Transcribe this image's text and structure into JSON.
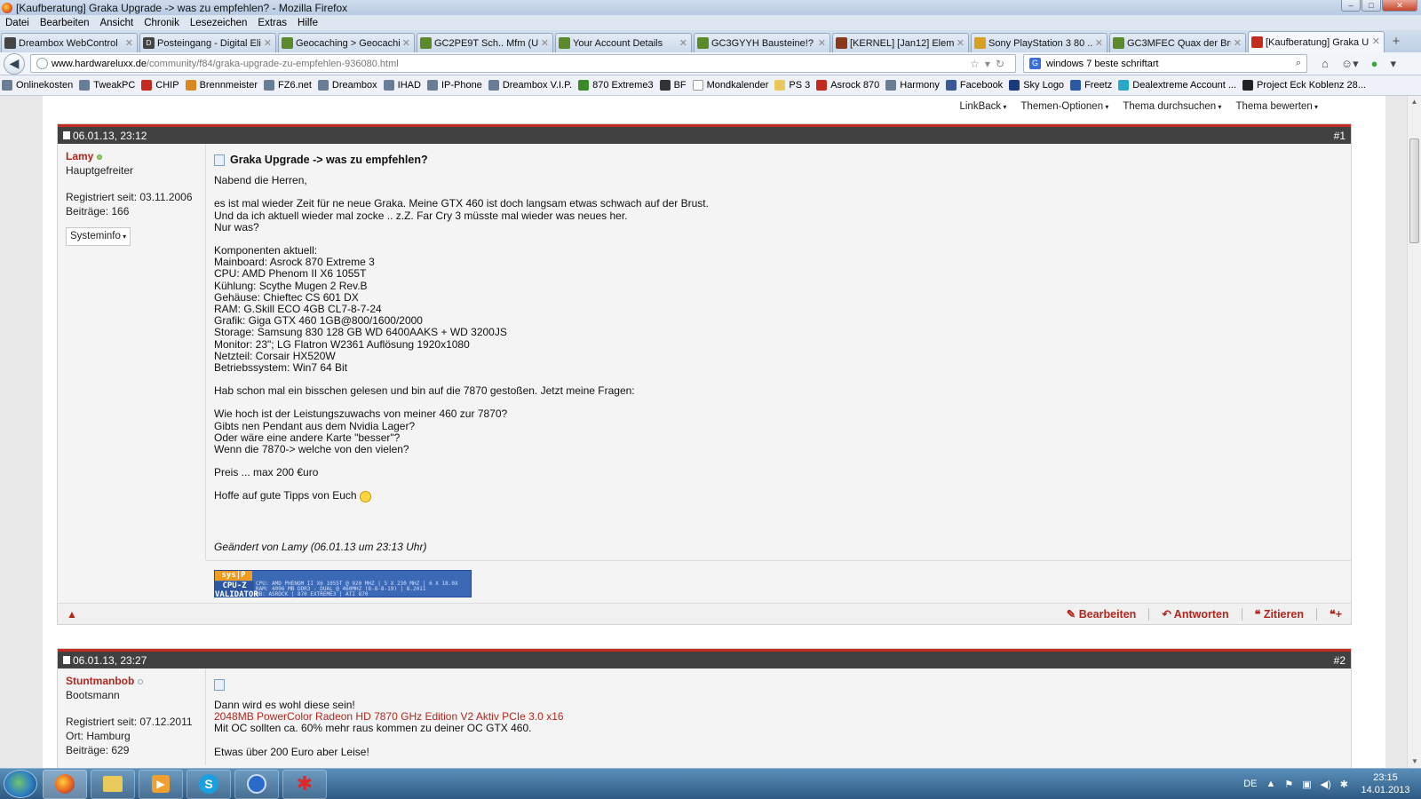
{
  "window": {
    "title": "[Kaufberatung] Graka Upgrade -> was zu empfehlen? - Mozilla Firefox"
  },
  "menu": [
    "Datei",
    "Bearbeiten",
    "Ansicht",
    "Chronik",
    "Lesezeichen",
    "Extras",
    "Hilfe"
  ],
  "tabs": [
    {
      "label": "Dreambox WebControl",
      "icon": "dreambox-icon"
    },
    {
      "label": "Posteingang - Digital Eli...",
      "icon": "mail-icon"
    },
    {
      "label": "Geocaching > Geocachi...",
      "icon": "geocaching-icon"
    },
    {
      "label": "GC2PE9T Sch.. Mfm (U...",
      "icon": "geocaching-icon"
    },
    {
      "label": "Your Account Details",
      "icon": "geocaching-icon"
    },
    {
      "label": "GC3GYYH Bausteine!? (...",
      "icon": "geocaching-icon"
    },
    {
      "label": "[KERNEL] [Jan12] Elem...",
      "icon": "forum-icon"
    },
    {
      "label": "Sony PlayStation 3 80 ...",
      "icon": "shop-icon"
    },
    {
      "label": "GC3MFEC Quax der Bru...",
      "icon": "geocaching-icon"
    },
    {
      "label": "[Kaufberatung] Graka U...",
      "icon": "hardwareluxx-icon"
    }
  ],
  "address": {
    "host": "www.hardwareluxx.de",
    "path": "/community/f84/graka-upgrade-zu-empfehlen-936080.html"
  },
  "search": {
    "value": "windows 7 beste schriftart"
  },
  "bookmarks": [
    "Onlinekosten",
    "TweakPC",
    "CHIP",
    "Brennmeister",
    "FZ6.net",
    "Dreambox",
    "IHAD",
    "IP-Phone",
    "Dreambox V.I.P.",
    "870 Extreme3",
    "BF",
    "Mondkalender",
    "PS 3",
    "Asrock 870",
    "Harmony",
    "Facebook",
    "Sky Logo",
    "Freetz",
    "Dealextreme Account ...",
    "Project Eck Koblenz 28..."
  ],
  "thread_tools": [
    "LinkBack",
    "Themen-Optionen",
    "Thema durchsuchen",
    "Thema bewerten"
  ],
  "posts": [
    {
      "date": "06.01.13, 23:12",
      "number": "#1",
      "user": "Lamy",
      "rank": "Hauptgefreiter",
      "registered": "Registriert seit: 03.11.2006",
      "posts_count": "Beiträge: 166",
      "sysinfo": "Systeminfo",
      "title": "Graka Upgrade -> was zu empfehlen?",
      "paragraphs": [
        [
          "Nabend die Herren,"
        ],
        [
          "es ist mal wieder Zeit für ne neue Graka. Meine GTX 460 ist doch langsam etwas schwach auf der Brust.",
          "Und da ich aktuell wieder mal zocke .. z.Z. Far Cry 3 müsste mal wieder was neues her.",
          "Nur was?"
        ],
        [
          "Komponenten aktuell:",
          "Mainboard: Asrock 870 Extreme 3",
          "CPU: AMD Phenom II X6 1055T",
          "Kühlung: Scythe Mugen 2 Rev.B",
          "Gehäuse: Chieftec CS 601 DX",
          "RAM: G.Skill ECO 4GB CL7-8-7-24",
          "Grafik: Giga GTX 460 1GB@800/1600/2000",
          "Storage: Samsung 830 128 GB WD 6400AAKS + WD 3200JS",
          "Monitor: 23\"; LG Flatron W2361 Auflösung 1920x1080",
          "Netzteil: Corsair HX520W",
          "Betriebssystem: Win7 64 Bit"
        ],
        [
          "Hab schon mal ein bisschen gelesen und bin auf die 7870 gestoßen. Jetzt meine Fragen:"
        ],
        [
          "Wie hoch ist der Leistungszuwachs von meiner 460 zur 7870?",
          "Gibts nen Pendant aus dem Nvidia Lager?",
          "Oder wäre eine andere Karte \"besser\"?",
          "Wenn die 7870-> welche von den vielen?"
        ],
        [
          "Preis ... max 200 €uro"
        ]
      ],
      "closing": "Hoffe auf gute Tipps von Euch",
      "edited": "Geändert von Lamy (06.01.13 um 23:13 Uhr)",
      "signature": {
        "badge": "sys|P",
        "logo": "CPU-Z VALIDATOR",
        "lines": [
          "CPU: AMD PHENOM II X6 1055T @ 920 MHZ | 5 X 230 MHZ | 6 X 18.0X",
          "RAM: 4096 MB DDR3 - DUAL @ 460MHZ (8-8-8-19) | 8.2011",
          "MB: ASROCK | 870 EXTREME3 | ATI 870"
        ]
      },
      "actions": [
        "Bearbeiten",
        "Antworten",
        "Zitieren"
      ]
    },
    {
      "date": "06.01.13, 23:27",
      "number": "#2",
      "user": "Stuntmanbob",
      "rank": "Bootsmann",
      "registered": "Registriert seit: 07.12.2011",
      "location": "Ort: Hamburg",
      "posts_count": "Beiträge: 629",
      "lines": [
        "Dann wird es wohl diese sein!",
        "2048MB PowerColor Radeon HD 7870 GHz Edition V2 Aktiv PCIe 3.0 x16",
        "Mit OC sollten ca. 60% mehr raus kommen zu deiner OC GTX 460.",
        "",
        "Etwas über 200 Euro aber Leise!"
      ]
    }
  ],
  "taskbar": {
    "apps": [
      "firefox-icon",
      "explorer-icon",
      "media-player-icon",
      "skype-icon",
      "teamviewer-icon",
      "app-icon"
    ],
    "language": "DE",
    "time": "23:15",
    "date": "14.01.2013"
  },
  "colors": {
    "accent": "#b3261e",
    "post_header": "#414141",
    "post_header_border": "#c32a20"
  }
}
